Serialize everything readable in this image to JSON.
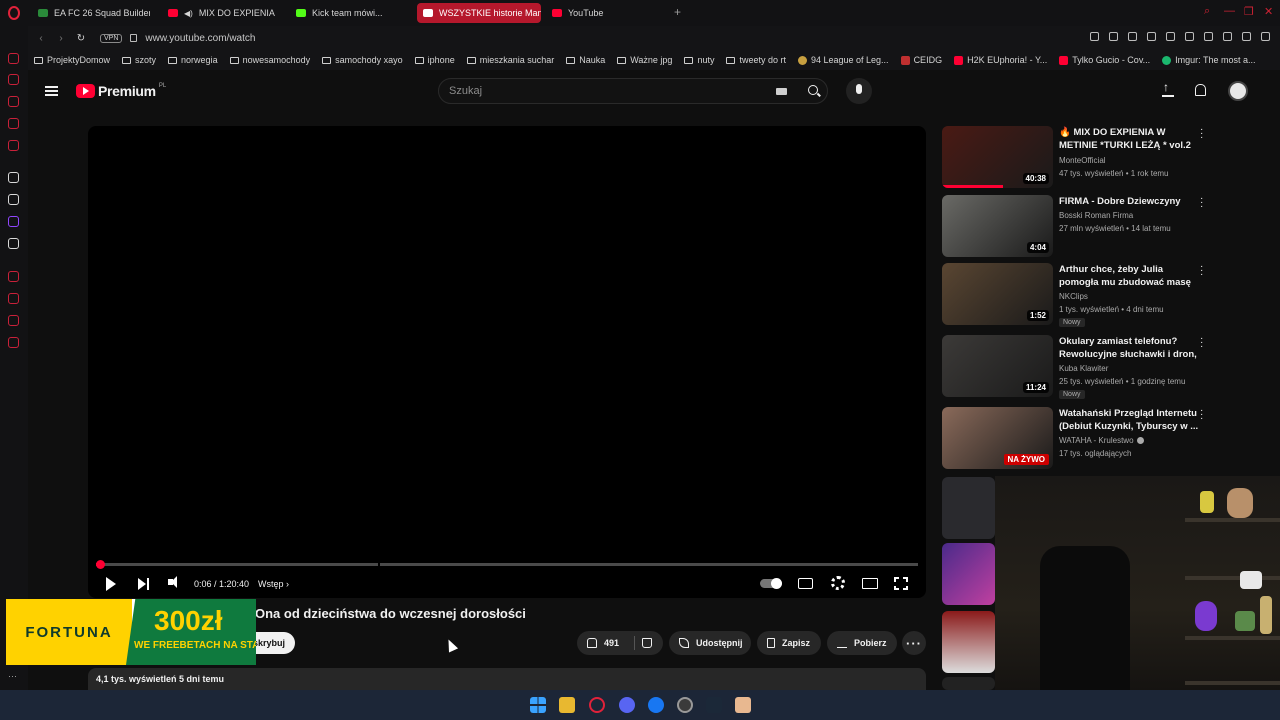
{
  "browser": {
    "tabs": [
      {
        "label": "EA FC 26 Squad Builder",
        "icon": "ea-icon"
      },
      {
        "label": "MIX DO EXPIENIA",
        "icon": "youtube-icon",
        "audio": "speaker-icon"
      },
      {
        "label": "Kick team mówi...",
        "icon": "kick-icon"
      },
      {
        "label": "WSZYSTKIE historie Man",
        "icon": "youtube-icon",
        "active": true
      },
      {
        "label": "YouTube",
        "icon": "youtube-icon"
      }
    ],
    "new_tab": "+",
    "url": "www.youtube.com/watch",
    "vpn_label": "VPN",
    "bookmarks": [
      {
        "label": "ProjektyDomow",
        "icon": "folder-icon"
      },
      {
        "label": "szoty",
        "icon": "folder-icon"
      },
      {
        "label": "norwegia",
        "icon": "folder-icon"
      },
      {
        "label": "nowesamochody",
        "icon": "folder-icon"
      },
      {
        "label": "samochody xayo",
        "icon": "folder-icon"
      },
      {
        "label": "iphone",
        "icon": "folder-icon"
      },
      {
        "label": "mieszkania suchar",
        "icon": "folder-icon"
      },
      {
        "label": "Nauka",
        "icon": "folder-icon"
      },
      {
        "label": "Ważne jpg",
        "icon": "folder-icon"
      },
      {
        "label": "nuty",
        "icon": "folder-icon"
      },
      {
        "label": "tweety do rt",
        "icon": "folder-icon"
      },
      {
        "label": "94 League of Leg...",
        "icon": "site-icon"
      },
      {
        "label": "CEIDG",
        "icon": "site-icon"
      },
      {
        "label": "H2K EUphoria! - Y...",
        "icon": "youtube-icon"
      },
      {
        "label": "Tylko Gucio - Cov...",
        "icon": "youtube-icon"
      },
      {
        "label": "Imgur: The most a...",
        "icon": "imgur-icon"
      }
    ]
  },
  "youtube": {
    "brand": "Premium",
    "country": "PL",
    "search_placeholder": "Szukaj",
    "player": {
      "time": "0:06 / 1:20:40",
      "chapter": "Wstęp ›",
      "progress": 0.0012
    },
    "video": {
      "title": "Ona od dzieciństwa do wczesnej dorosłości",
      "subscribe_label": "skrybuj",
      "likes": "491",
      "share_label": "Udostępnij",
      "save_label": "Zapisz",
      "download_label": "Pobierz",
      "more_label": "···",
      "views_line": "4,1 tys. wyświetleń  5 dni temu"
    },
    "ad": {
      "brand": "FORTUNA",
      "amount": "300zł",
      "tagline": "WE FREEBETACH NA START"
    },
    "recommendations": [
      {
        "title": "🔥 MIX DO EXPIENIA W METINIE *TURKI LEŻĄ * vol.2",
        "channel": "MonteOfficial",
        "meta": "47 tys. wyświetleń • 1 rok temu",
        "duration": "40:38",
        "watched": 0.55,
        "thumb_color": "#4a1a14"
      },
      {
        "title": "FIRMA - Dobre Dziewczyny",
        "channel": "Bosski Roman Firma",
        "meta": "27 mln wyświetleń • 14 lat temu",
        "duration": "4:04",
        "thumb_color": "#6a6a66"
      },
      {
        "title": "Arthur chce, żeby Julia pomogła mu zbudować masę mięśniow...",
        "channel": "NKClips",
        "meta": "1 tys. wyświetleń • 4 dni temu",
        "duration": "1:52",
        "badge": "Nowy",
        "thumb_color": "#5a4632"
      },
      {
        "title": "Okulary zamiast telefonu? Rewolucyjne słuchawki i dron, ...",
        "channel": "Kuba Klawiter",
        "meta": "25 tys. wyświetleń • 1 godzinę temu",
        "duration": "11:24",
        "badge": "Nowy",
        "thumb_color": "#3c3a38"
      },
      {
        "title": "Watahański Przegląd Internetu (Debiut Kuzynki, Tyburscy w ...",
        "channel": "WATAHA - Krulestwo",
        "meta": "17 tys. oglądających",
        "live": "NA ŻYWO",
        "thumb_color": "#8a6a5a"
      }
    ]
  },
  "colors": {
    "accent": "#ff0033",
    "opera_red": "#e0223a",
    "background": "#0f0f0f",
    "chip": "#272727"
  }
}
